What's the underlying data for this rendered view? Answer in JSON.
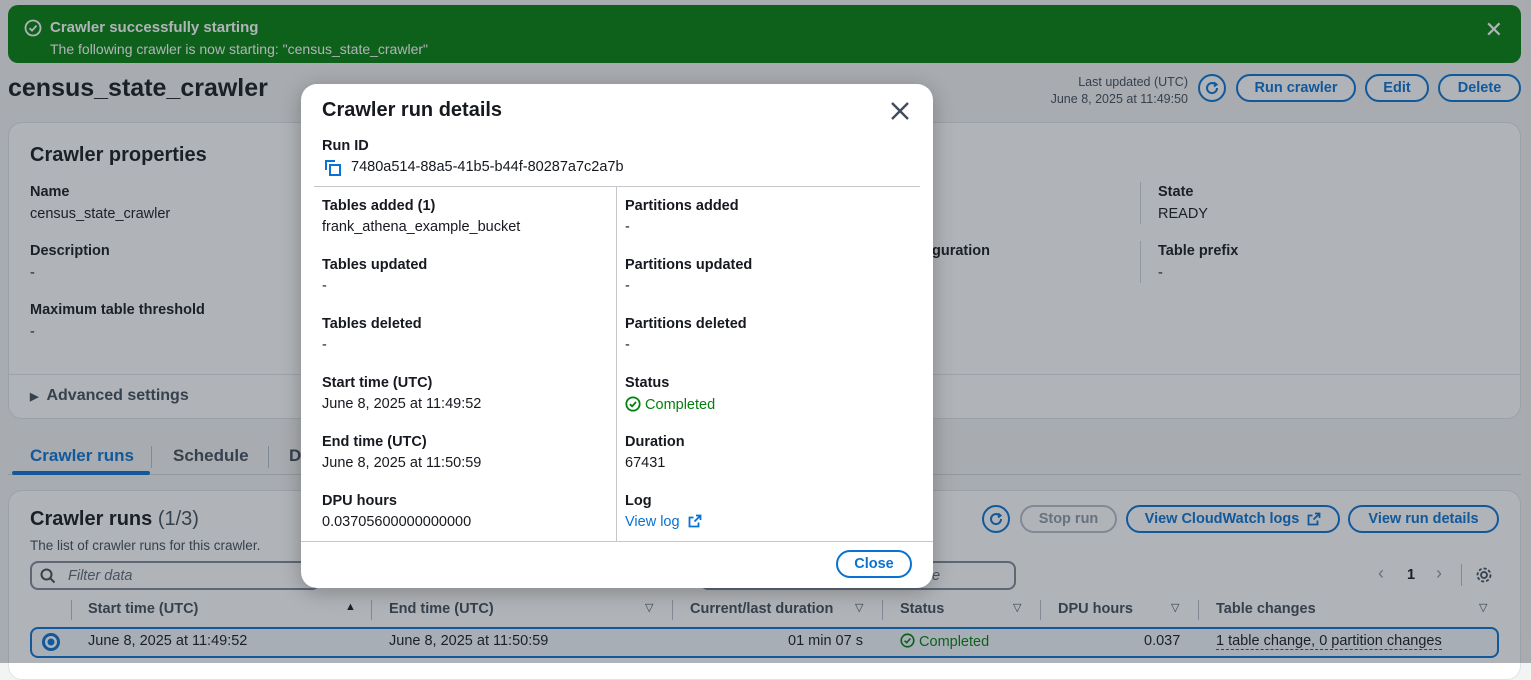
{
  "flash": {
    "title": "Crawler successfully starting",
    "message": "The following crawler is now starting: \"census_state_crawler\""
  },
  "header": {
    "title": "census_state_crawler",
    "last_updated_label": "Last updated (UTC)",
    "last_updated_value": "June 8, 2025 at 11:49:50",
    "buttons": {
      "run": "Run crawler",
      "edit": "Edit",
      "delete": "Delete"
    }
  },
  "properties": {
    "title": "Crawler properties",
    "name_label": "Name",
    "name_value": "census_state_crawler",
    "description_label": "Description",
    "description_value": "-",
    "max_table_label": "Maximum table threshold",
    "max_table_value": "-",
    "config_fragment": "guration",
    "state_label": "State",
    "state_value": "READY",
    "table_prefix_label": "Table prefix",
    "table_prefix_value": "-",
    "advanced": "Advanced settings"
  },
  "tabs": {
    "runs": "Crawler runs",
    "schedule": "Schedule",
    "partial": "D"
  },
  "runs_panel": {
    "title": "Crawler runs",
    "count": "(1/3)",
    "description": "The list of crawler runs for this crawler.",
    "filter_placeholder": "Filter data",
    "partial_field_text": "e",
    "buttons": {
      "stop": "Stop run",
      "cloudwatch": "View CloudWatch logs",
      "details": "View run details"
    },
    "page": "1",
    "columns": [
      "Start time (UTC)",
      "End time (UTC)",
      "Current/last duration",
      "Status",
      "DPU hours",
      "Table changes"
    ],
    "row": {
      "start": "June 8, 2025 at 11:49:52",
      "end": "June 8, 2025 at 11:50:59",
      "duration": "01 min 07 s",
      "status": "Completed",
      "dpu": "0.037",
      "changes": "1 table change, 0 partition changes"
    }
  },
  "modal": {
    "title": "Crawler run details",
    "run_id_label": "Run ID",
    "run_id": "7480a514-88a5-41b5-b44f-80287a7c2a7b",
    "tables_added_label": "Tables added (1)",
    "tables_added_value": "frank_athena_example_bucket",
    "tables_updated_label": "Tables updated",
    "tables_updated_value": "-",
    "tables_deleted_label": "Tables deleted",
    "tables_deleted_value": "-",
    "start_label": "Start time (UTC)",
    "start_value": "June 8, 2025 at 11:49:52",
    "end_label": "End time (UTC)",
    "end_value": "June 8, 2025 at 11:50:59",
    "dpu_label": "DPU hours",
    "dpu_value": "0.03705600000000000",
    "part_added_label": "Partitions added",
    "part_added_value": "-",
    "part_updated_label": "Partitions updated",
    "part_updated_value": "-",
    "part_deleted_label": "Partitions deleted",
    "part_deleted_value": "-",
    "status_label": "Status",
    "status_value": "Completed",
    "duration_label": "Duration",
    "duration_value": "67431",
    "log_label": "Log",
    "log_link": "View log",
    "close_button": "Close"
  }
}
